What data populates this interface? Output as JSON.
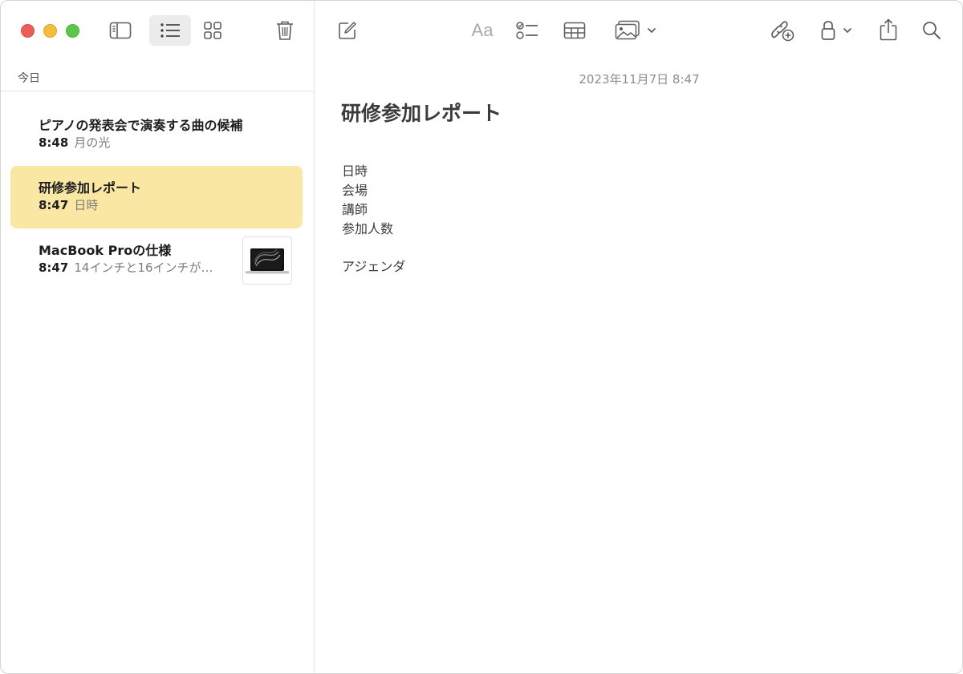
{
  "toolbar": {
    "left_buttons": [
      "sidebar-toggle-icon",
      "list-view-icon",
      "gallery-view-icon",
      "trash-icon"
    ],
    "right_buttons": [
      "compose-icon",
      "format-text-icon",
      "checklist-icon",
      "table-icon",
      "media-icon",
      "collaborate-icon",
      "lock-icon",
      "share-icon",
      "search-icon"
    ],
    "format_label": "Aa"
  },
  "sidebar": {
    "section_header": "今日",
    "notes": [
      {
        "title": "ピアノの発表会で演奏する曲の候補",
        "time": "8:48",
        "preview": "月の光",
        "selected": false,
        "has_thumbnail": false
      },
      {
        "title": "研修参加レポート",
        "time": "8:47",
        "preview": "日時",
        "selected": true,
        "has_thumbnail": false
      },
      {
        "title": "MacBook Proの仕様",
        "time": "8:47",
        "preview": "14インチと16インチが…",
        "selected": false,
        "has_thumbnail": true
      }
    ]
  },
  "editor": {
    "date": "2023年11月7日 8:47",
    "title": "研修参加レポート",
    "body_lines": [
      "日時",
      "会場",
      "講師",
      "参加人数",
      "",
      "アジェンダ"
    ]
  },
  "colors": {
    "selected_note": "#fae7a3",
    "close": "#ec5f57",
    "minimize": "#f3be3e",
    "maximize": "#5cc646",
    "icon": "#5e5e5e"
  }
}
